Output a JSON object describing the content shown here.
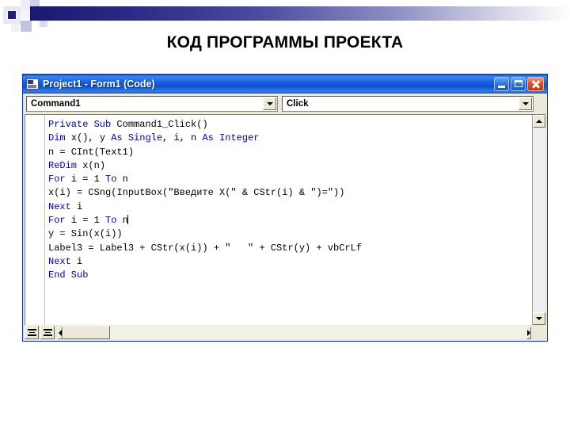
{
  "slide": {
    "title": "КОД ПРОГРАММЫ ПРОЕКТА",
    "accent_color": "#191970",
    "background": "#ffffff"
  },
  "window": {
    "title": "Project1 - Form1 (Code)",
    "titlebar_color": "#1a63dd",
    "app_icon": "vb-form-icon",
    "controls": {
      "minimize": "minimize-icon",
      "maximize": "maximize-icon",
      "close": "close-icon",
      "close_color": "#e44f2c"
    }
  },
  "toolbar": {
    "object_combo": {
      "value": "Command1",
      "arrow": "chevron-down-icon"
    },
    "procedure_combo": {
      "value": "Click",
      "arrow": "chevron-down-icon"
    }
  },
  "editor": {
    "keyword_color": "#0000c8",
    "text_color": "#000000",
    "background": "#ffffff",
    "caret_line_index": 7,
    "lines": [
      [
        {
          "t": "Private Sub ",
          "k": true
        },
        {
          "t": "Command1_Click()",
          "k": false
        }
      ],
      [
        {
          "t": "Dim ",
          "k": true
        },
        {
          "t": "x(), y ",
          "k": false
        },
        {
          "t": "As Single",
          "k": true
        },
        {
          "t": ", i, n ",
          "k": false
        },
        {
          "t": "As Integer",
          "k": true
        }
      ],
      [
        {
          "t": "n = CInt(Text1)",
          "k": false
        }
      ],
      [
        {
          "t": "ReDim ",
          "k": true
        },
        {
          "t": "x(n)",
          "k": false
        }
      ],
      [
        {
          "t": "For ",
          "k": true
        },
        {
          "t": "i = 1 ",
          "k": false
        },
        {
          "t": "To ",
          "k": true
        },
        {
          "t": "n",
          "k": false
        }
      ],
      [
        {
          "t": "x(i) = CSng(InputBox(\"Введите X(\" & CStr(i) & \")=\"))",
          "k": false
        }
      ],
      [
        {
          "t": "Next ",
          "k": true
        },
        {
          "t": "i",
          "k": false
        }
      ],
      [
        {
          "t": "For ",
          "k": true
        },
        {
          "t": "i = 1 ",
          "k": false
        },
        {
          "t": "To ",
          "k": true
        },
        {
          "t": "n",
          "k": false
        }
      ],
      [
        {
          "t": "y = Sin(x(i))",
          "k": false
        }
      ],
      [
        {
          "t": "Label3 = Label3 + CStr(x(i)) + \"   \" + CStr(y) + vbCrLf",
          "k": false
        }
      ],
      [
        {
          "t": "Next ",
          "k": true
        },
        {
          "t": "i",
          "k": false
        }
      ],
      [
        {
          "t": "End Sub",
          "k": true
        }
      ]
    ]
  },
  "scrollbars": {
    "vertical": {
      "up": "scroll-up-icon",
      "down": "scroll-down-icon"
    },
    "horizontal": {
      "left": "scroll-left-icon",
      "right": "scroll-right-icon"
    }
  },
  "status_bar": {
    "procedure_view": "procedure-view-icon",
    "full_module_view": "full-module-view-icon",
    "resize_grip": "resize-grip-icon"
  }
}
